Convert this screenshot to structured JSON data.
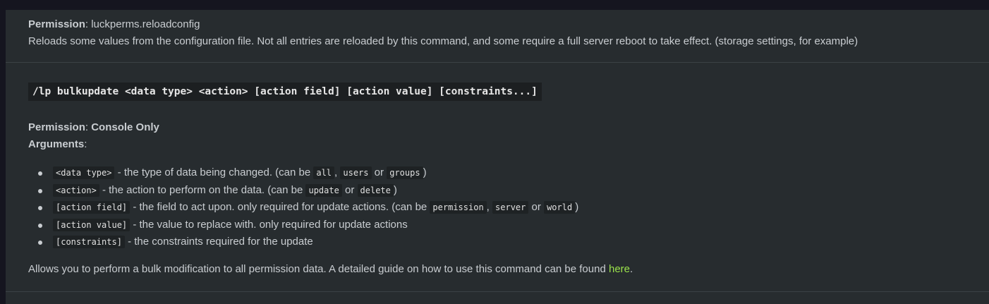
{
  "reloadconfig": {
    "permission_label": "Permission",
    "permission_value": ": luckperms.reloadconfig",
    "description": "Reloads some values from the configuration file. Not all entries are reloaded by this command, and some require a full server reboot to take effect. (storage settings, for example)"
  },
  "bulkupdate": {
    "command": "/lp bulkupdate <data type> <action> [action field] [action value] [constraints...]",
    "permission_label": "Permission",
    "permission_sep": ": ",
    "permission_value": "Console Only",
    "arguments_label": "Arguments",
    "arguments_sep": ":",
    "arguments": [
      {
        "code": "<data type>",
        "t1": " - the type of data being changed. (can be ",
        "c1": "all",
        "t2": ", ",
        "c2": "users",
        "t3": " or ",
        "c3": "groups",
        "t4": ")"
      },
      {
        "code": "<action>",
        "t1": " - the action to perform on the data. (can be ",
        "c1": "update",
        "t2": " or ",
        "c2": "delete",
        "t3": ")"
      },
      {
        "code": "[action field]",
        "t1": " - the field to act upon. only required for update actions. (can be ",
        "c1": "permission",
        "t2": ", ",
        "c2": "server",
        "t3": " or ",
        "c3": "world",
        "t4": ")"
      },
      {
        "code": "[action value]",
        "t1": " - the value to replace with. only required for update actions"
      },
      {
        "code": "[constraints]",
        "t1": " - the constraints required for the update"
      }
    ],
    "footer_text": "Allows you to perform a bulk modification to all permission data. A detailed guide on how to use this command can be found ",
    "footer_link": "here",
    "footer_end": "."
  },
  "colors": {
    "link": "#9be34b",
    "background": "#272c2f"
  }
}
